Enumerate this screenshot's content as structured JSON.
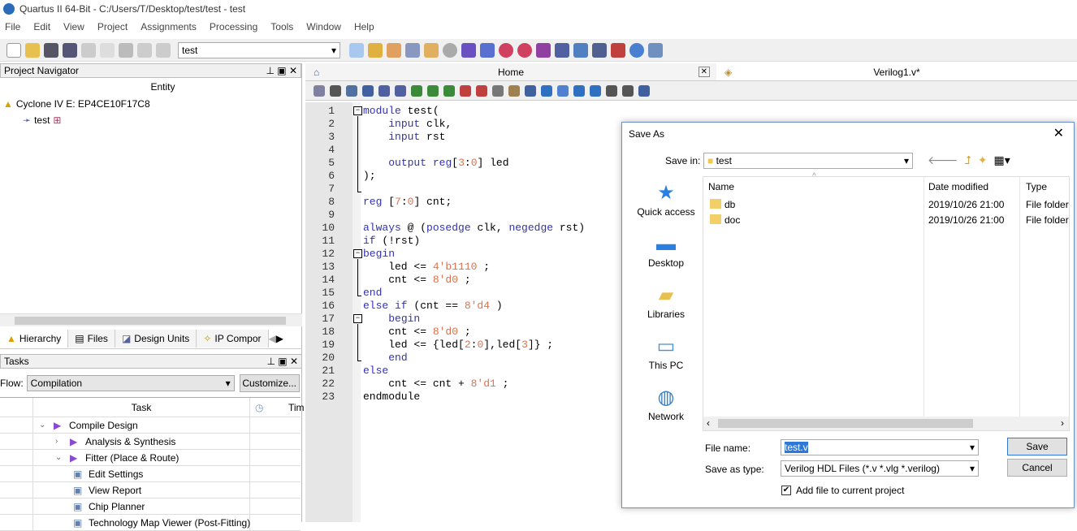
{
  "window": {
    "title": "Quartus II 64-Bit - C:/Users/T/Desktop/test/test - test"
  },
  "menu": [
    "File",
    "Edit",
    "View",
    "Project",
    "Assignments",
    "Processing",
    "Tools",
    "Window",
    "Help"
  ],
  "toolbar": {
    "entity_select": "test"
  },
  "project_navigator": {
    "title": "Project Navigator",
    "column": "Entity",
    "device": "Cyclone IV E: EP4CE10F17C8",
    "top_entity": "test",
    "tabs": [
      "Hierarchy",
      "Files",
      "Design Units",
      "IP Compor"
    ]
  },
  "tasks": {
    "title": "Tasks",
    "flow_label": "Flow:",
    "flow_value": "Compilation",
    "customize": "Customize...",
    "col_task": "Task",
    "col_time": "Tim",
    "items": [
      {
        "label": "Compile Design",
        "level": 0,
        "expander": "v"
      },
      {
        "label": "Analysis & Synthesis",
        "level": 1,
        "expander": ">"
      },
      {
        "label": "Fitter (Place & Route)",
        "level": 1,
        "expander": "v"
      },
      {
        "label": "Edit Settings",
        "level": 2
      },
      {
        "label": "View Report",
        "level": 2
      },
      {
        "label": "Chip Planner",
        "level": 2
      },
      {
        "label": "Technology Map Viewer (Post-Fitting)",
        "level": 2
      }
    ]
  },
  "editor_tabs": {
    "home": "Home",
    "file": "Verilog1.v*"
  },
  "code": [
    [
      [
        "module",
        "kw"
      ],
      [
        " test(",
        ""
      ]
    ],
    [
      [
        "    ",
        ""
      ],
      [
        "input",
        "kw"
      ],
      [
        " clk,",
        ""
      ]
    ],
    [
      [
        "    ",
        ""
      ],
      [
        "input",
        "kw"
      ],
      [
        " rst",
        ""
      ]
    ],
    [],
    [
      [
        "    ",
        ""
      ],
      [
        "output",
        "kw"
      ],
      [
        " ",
        ""
      ],
      [
        "reg",
        "kw"
      ],
      [
        "[",
        ""
      ],
      [
        "3",
        "nm"
      ],
      [
        ":",
        ""
      ],
      [
        "0",
        "nm"
      ],
      [
        "] led",
        ""
      ]
    ],
    [
      [
        ");",
        ""
      ]
    ],
    [],
    [
      [
        "reg",
        "kw"
      ],
      [
        " [",
        ""
      ],
      [
        "7",
        "nm"
      ],
      [
        ":",
        ""
      ],
      [
        "0",
        "nm"
      ],
      [
        "] cnt;",
        ""
      ]
    ],
    [],
    [
      [
        "always",
        "kw"
      ],
      [
        " @ (",
        ""
      ],
      [
        "posedge",
        "kw"
      ],
      [
        " clk, ",
        ""
      ],
      [
        "negedge",
        "kw"
      ],
      [
        " rst)",
        ""
      ]
    ],
    [
      [
        "if",
        "kw"
      ],
      [
        " (!rst)",
        ""
      ]
    ],
    [
      [
        "begin",
        "kw"
      ]
    ],
    [
      [
        "    led <= ",
        ""
      ],
      [
        "4'b1110",
        "nm"
      ],
      [
        " ;",
        ""
      ]
    ],
    [
      [
        "    cnt <= ",
        ""
      ],
      [
        "8'd0",
        "nm"
      ],
      [
        " ;",
        ""
      ]
    ],
    [
      [
        "end",
        "kw"
      ]
    ],
    [
      [
        "else if",
        "kw"
      ],
      [
        " (cnt == ",
        ""
      ],
      [
        "8'd4",
        "nm"
      ],
      [
        " )",
        ""
      ]
    ],
    [
      [
        "    ",
        ""
      ],
      [
        "begin",
        "kw"
      ]
    ],
    [
      [
        "    cnt <= ",
        ""
      ],
      [
        "8'd0",
        "nm"
      ],
      [
        " ;",
        ""
      ]
    ],
    [
      [
        "    led <= {led[",
        ""
      ],
      [
        "2",
        "nm"
      ],
      [
        ":",
        ""
      ],
      [
        "0",
        "nm"
      ],
      [
        "],led[",
        ""
      ],
      [
        "3",
        "nm"
      ],
      [
        "]} ;",
        ""
      ]
    ],
    [
      [
        "    ",
        ""
      ],
      [
        "end",
        "kw"
      ]
    ],
    [
      [
        "else",
        "kw"
      ]
    ],
    [
      [
        "    cnt <= cnt + ",
        ""
      ],
      [
        "8'd1",
        "nm"
      ],
      [
        " ;",
        ""
      ]
    ],
    [
      [
        "endmodule",
        ""
      ]
    ]
  ],
  "save_dialog": {
    "title": "Save As",
    "save_in_label": "Save in:",
    "save_in_value": "test",
    "places": [
      "Quick access",
      "Desktop",
      "Libraries",
      "This PC",
      "Network"
    ],
    "columns": [
      "Name",
      "Date modified",
      "Type"
    ],
    "files": [
      {
        "name": "db",
        "date": "2019/10/26 21:00",
        "type": "File folder"
      },
      {
        "name": "doc",
        "date": "2019/10/26 21:00",
        "type": "File folder"
      }
    ],
    "file_name_label": "File name:",
    "file_name_value": "test.v",
    "save_type_label": "Save as type:",
    "save_type_value": "Verilog HDL Files (*.v *.vlg *.verilog)",
    "add_to_project": "Add file to current project",
    "add_to_project_checked": true,
    "save": "Save",
    "cancel": "Cancel"
  }
}
